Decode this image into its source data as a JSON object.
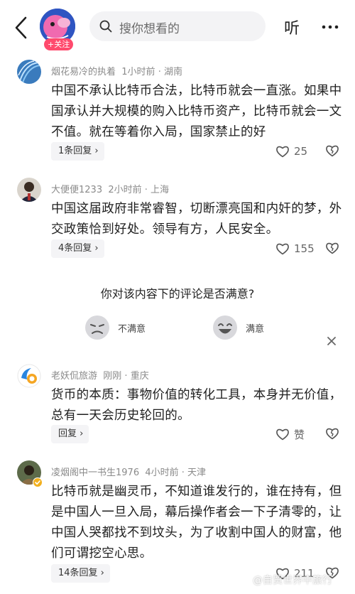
{
  "header": {
    "follow_label": "+关注",
    "search_placeholder": "搜你想看的",
    "listen_label": "听"
  },
  "comments": [
    {
      "username": "烟花易冷的执着",
      "time": "1小时前",
      "location": "湖南",
      "text": "中国不承认比特币合法，比特币就会一直涨。如果中国承认并大规模的购入比特币资产，比特币就会一文不值。就在等着你入局，国家禁止的好",
      "reply_label": "1条回复",
      "likes": "25"
    },
    {
      "username": "大便便1233",
      "time": "2小时前",
      "location": "上海",
      "text": "中国这届政府非常睿智，切断漂亮国和内奸的梦，外交政策恰到好处。领导有方，人民安全。",
      "reply_label": "4条回复",
      "likes": "155"
    },
    {
      "username": "老妖侃旅游",
      "time": "刚刚",
      "location": "重庆",
      "text": "货币的本质：事物价值的转化工具，本身并无价值，总有一天会历史轮回的。",
      "reply_label": "回复",
      "likes": "赞"
    },
    {
      "username": "凌烟阁中一书生1976",
      "time": "4小时前",
      "location": "天津",
      "text": "比特币就是幽灵币，不知道谁发行的，谁在持有，但是中国人一旦入局，幕后操作者会一下子清零的，让中国人哭都找不到坟头，为了收割中国人的财富，他们可谓挖空心思。",
      "reply_label": "14条回复",
      "likes": "211"
    }
  ],
  "survey": {
    "question": "你对该内容下的评论是否满意?",
    "option_unsatisfied": "不满意",
    "option_satisfied": "满意"
  },
  "watermark": "@自贸世界中旅行",
  "colors": {
    "follow_badge": "#ff4a6d",
    "search_bg": "#f3f3f5",
    "reply_bg": "#f4f4f6",
    "meta_text": "#8a8a8a"
  },
  "icons": [
    "back-arrow-icon",
    "search-icon",
    "more-icon",
    "thumb-up-icon",
    "broken-heart-icon",
    "unhappy-face-icon",
    "happy-face-icon",
    "close-icon"
  ]
}
